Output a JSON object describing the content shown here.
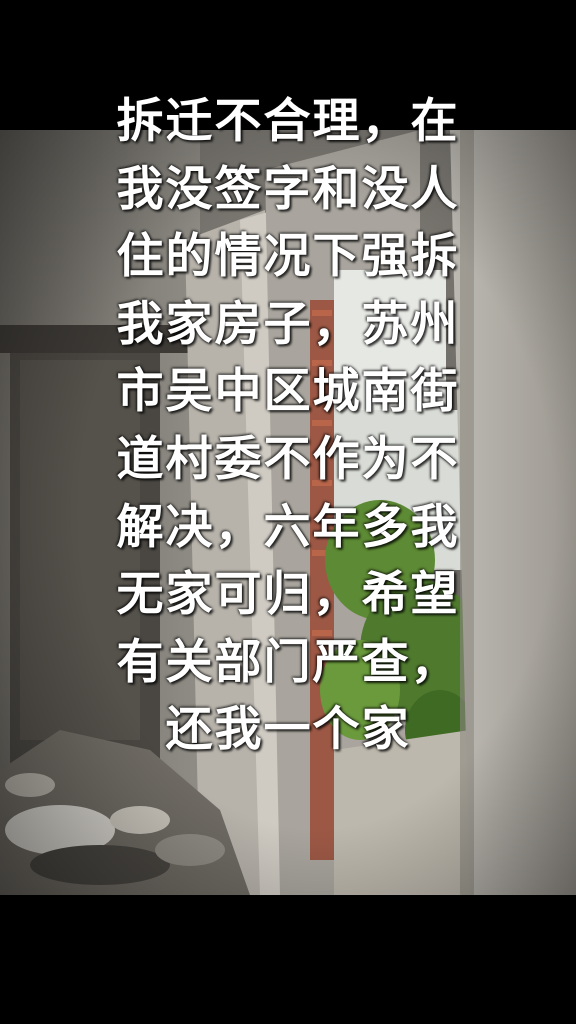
{
  "caption": {
    "lines": [
      "拆迁不合理，在",
      "我没签字和没人",
      "住的情况下强拆",
      "我家房子，苏州",
      "市吴中区城南街",
      "道村委不作为不",
      "解决，六年多我",
      "无家可归，希望",
      "有关部门严查，",
      "还我一个家"
    ],
    "color": "#ffffff"
  },
  "photo": {
    "subject": "demolished-house-interior",
    "wall_color": "#9d9b95",
    "dark_wall_color": "#4e4b47",
    "greenery_color": "#4f7a2e",
    "sky_color": "#e6e8e4"
  }
}
